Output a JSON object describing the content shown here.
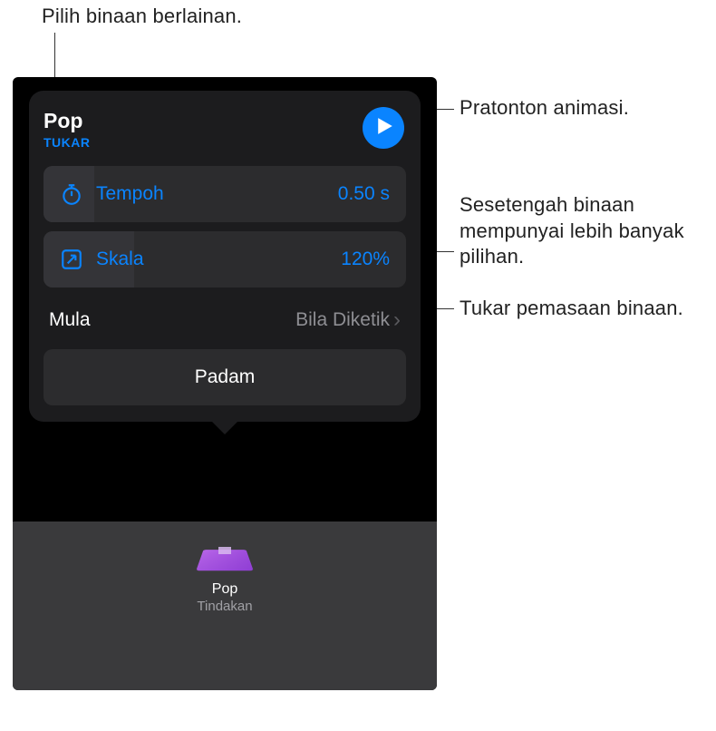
{
  "callouts": {
    "change": "Pilih binaan berlainan.",
    "preview": "Pratonton animasi.",
    "options": "Sesetengah binaan mempunyai lebih banyak pilihan.",
    "timing": "Tukar pemasaan binaan."
  },
  "popover": {
    "title": "Pop",
    "change_label": "TUKAR",
    "duration": {
      "label": "Tempoh",
      "value": "0.50 s"
    },
    "scale": {
      "label": "Skala",
      "value": "120%"
    },
    "start": {
      "label": "Mula",
      "value": "Bila Diketik"
    },
    "delete_label": "Padam"
  },
  "action_tile": {
    "title": "Pop",
    "subtitle": "Tindakan"
  }
}
